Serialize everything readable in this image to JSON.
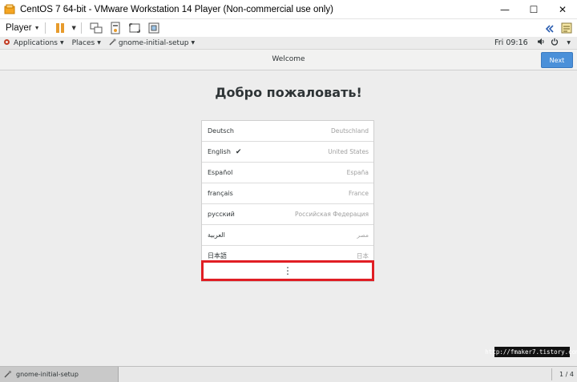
{
  "window": {
    "title": "CentOS 7 64-bit - VMware Workstation 14 Player (Non-commercial use only)",
    "minimize_glyph": "—",
    "maximize_glyph": "☐",
    "close_glyph": "✕"
  },
  "vm_toolbar": {
    "player_label": "Player"
  },
  "gnome_top": {
    "applications": "Applications",
    "places": "Places",
    "app_name": "gnome-initial-setup",
    "clock": "Fri 09:16"
  },
  "header": {
    "title": "Welcome",
    "next_label": "Next"
  },
  "page": {
    "heading": "Добро пожаловать!"
  },
  "languages": [
    {
      "name": "Deutsch",
      "region": "Deutschland",
      "selected": false
    },
    {
      "name": "English",
      "region": "United States",
      "selected": true
    },
    {
      "name": "Español",
      "region": "España",
      "selected": false
    },
    {
      "name": "français",
      "region": "France",
      "selected": false
    },
    {
      "name": "русский",
      "region": "Российская Федерация",
      "selected": false
    },
    {
      "name": "العربية",
      "region": "مصر",
      "selected": false
    },
    {
      "name": "日本語",
      "region": "日本",
      "selected": false
    }
  ],
  "more_row": {
    "glyph": "⋮",
    "highlight_color": "#e01e24"
  },
  "watermark": {
    "text": "http://fmaker7.tistory.com"
  },
  "taskbar": {
    "item_label": "gnome-initial-setup",
    "pager": "1 / 4"
  },
  "colors": {
    "next_button": "#4a90d9",
    "content_bg": "#ededed"
  }
}
